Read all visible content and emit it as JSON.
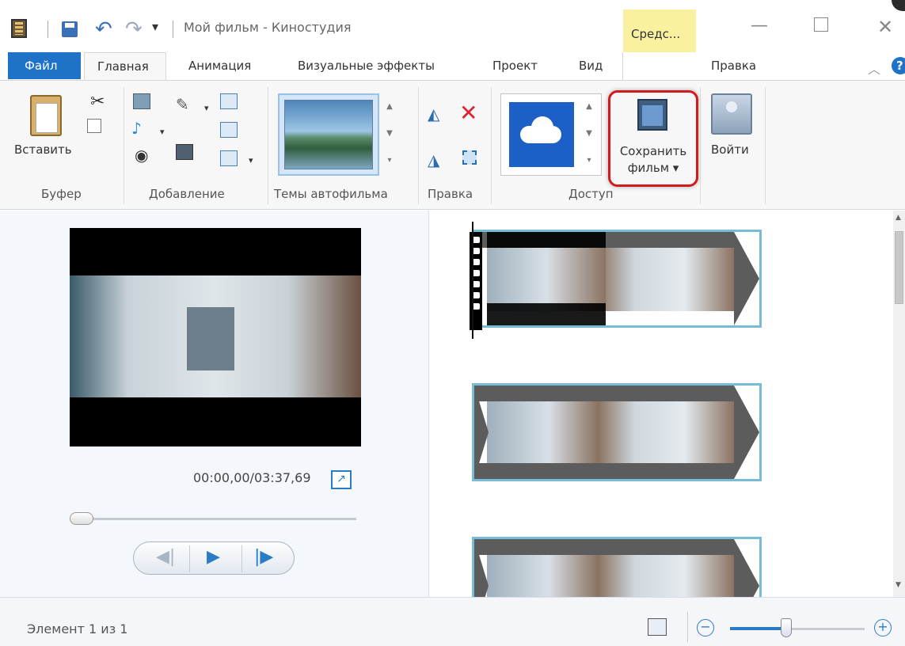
{
  "window": {
    "title": "Мой фильм - Киностудия",
    "context_tab": "Средс...",
    "colors": {
      "file_tab": "#1e72c8",
      "highlight": "#d11a1a",
      "clip_border": "#79bcd8",
      "context_tab_bg": "#f9f0a0"
    }
  },
  "tabs": [
    "Файл",
    "Главная",
    "Анимация",
    "Визуальные эффекты",
    "Проект",
    "Вид",
    "Правка"
  ],
  "ribbon": {
    "clipboard": {
      "paste": "Вставить",
      "group": "Буфер"
    },
    "add": {
      "group": "Добавление"
    },
    "themes": {
      "group": "Темы автофильма"
    },
    "editing": {
      "group": "Правка"
    },
    "share": {
      "group": "Доступ",
      "save_movie_line1": "Сохранить",
      "save_movie_line2": "фильм ▾"
    },
    "signin": {
      "label": "Войти"
    }
  },
  "preview": {
    "time": "00:00,00/03:37,69",
    "seek_progress": 0
  },
  "storyboard": {
    "clips_visible": 3,
    "selected_clip": 1
  },
  "status": {
    "text": "Элемент 1 из 1",
    "zoom_level": 0.4
  },
  "icons": [
    "app-icon",
    "save-icon",
    "undo-icon",
    "redo-icon",
    "cut-icon",
    "copy-icon",
    "photo-icon",
    "music-icon",
    "webcam-icon",
    "narration-icon",
    "snapshot-icon",
    "title-icon",
    "caption-icon",
    "credits-icon",
    "rotate-left-icon",
    "rotate-right-icon",
    "remove-icon",
    "select-all-icon",
    "onedrive-icon",
    "save-movie-icon",
    "signin-icon",
    "fullscreen-icon",
    "help-icon"
  ]
}
